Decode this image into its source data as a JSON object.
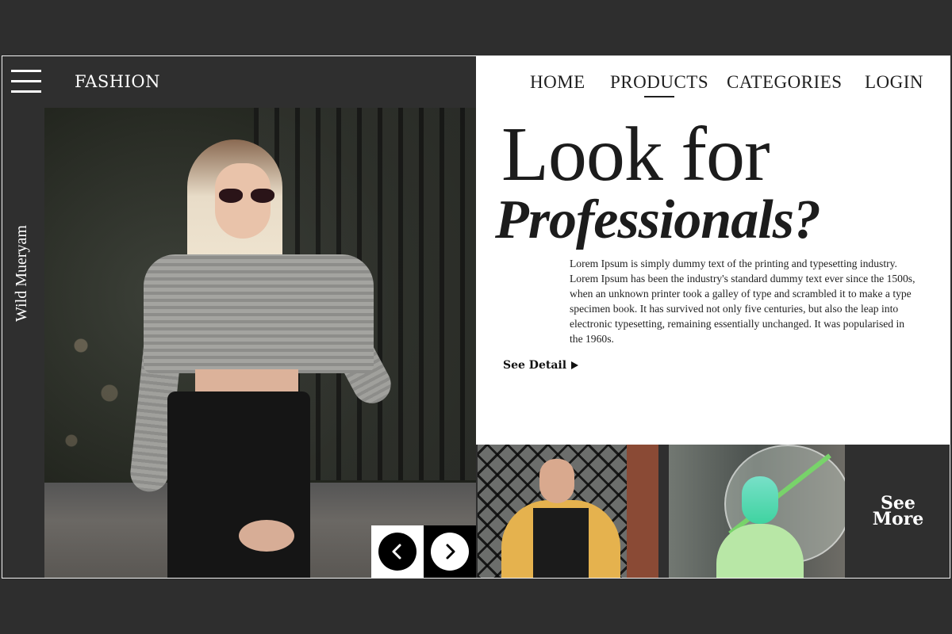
{
  "header": {
    "brand": "FASHION",
    "menu_icon": "hamburger-menu-icon"
  },
  "sidebar": {
    "vertical_label": "Wild Mueryam"
  },
  "nav": {
    "items": [
      {
        "label": "HOME"
      },
      {
        "label": "PRODUCTS",
        "active": true
      },
      {
        "label": "CATEGORIES"
      },
      {
        "label": "LOGIN"
      }
    ]
  },
  "hero": {
    "headline_line1": "Look for",
    "headline_line2": "Professionals?",
    "body": "Lorem Ipsum is simply dummy text of the printing and typesetting industry. Lorem Ipsum has been the industry's standard dummy text ever since the 1500s, when an unknown printer took a galley of type and scrambled it to make a type specimen book. It has survived not only five centuries, but also the leap into electronic typesetting, remaining essentially unchanged. It was popularised in the 1960s.",
    "cta_label": "See Detail",
    "cta_icon": "play-arrow-icon"
  },
  "carousel": {
    "prev_icon": "chevron-left-icon",
    "next_icon": "chevron-right-icon"
  },
  "gallery": {
    "see_more_label": "See More"
  },
  "colors": {
    "dark": "#2f2f2f",
    "light": "#ffffff",
    "text": "#1c1c1c"
  }
}
